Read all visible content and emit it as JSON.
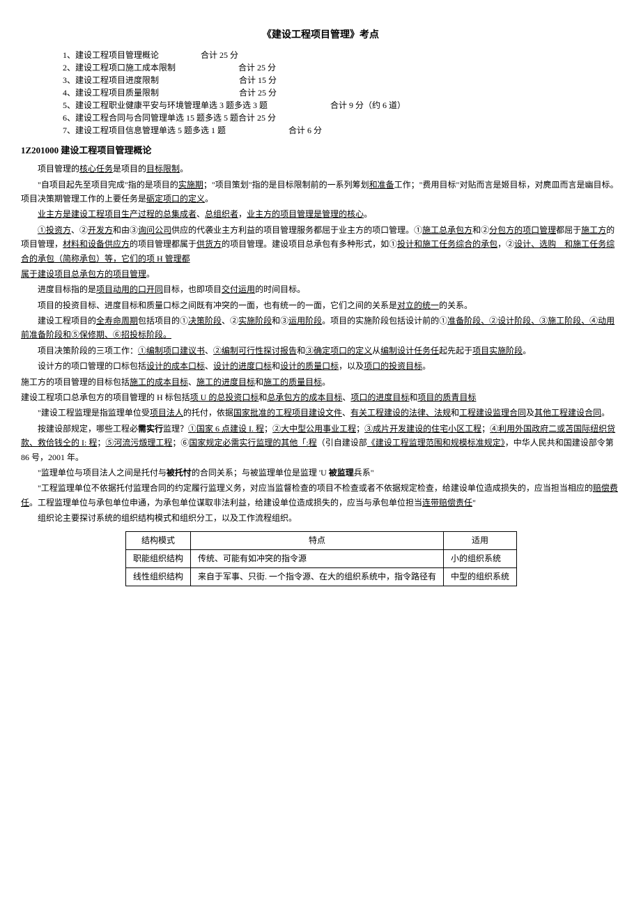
{
  "title": "《建设工程项目管理》考点",
  "toc": [
    {
      "num": "1、",
      "name": "建设工程项目管理概论",
      "score": "合计 25 分"
    },
    {
      "num": "2、",
      "name": "建设工程项口施工成本限制",
      "score": "合计 25 分"
    },
    {
      "num": "3、",
      "name": "建设工程项目进度限制",
      "score": "合计 15 分"
    },
    {
      "num": "4、",
      "name": "建设工程项目质量限制",
      "score": "合计 25 分"
    },
    {
      "num": "5、",
      "name": "建设工程职业健康平安与环境管理单选 3 题多选 3 题",
      "score": "合计 9 分（约 6 道）"
    },
    {
      "num": "6、",
      "name": "建设工程合同与合同管理单选 15 题多选 5 题合计 25 分",
      "score": ""
    },
    {
      "num": "7、",
      "name": "建设工程项目信息管理单选 5 题多选 1 题",
      "score": "合计 6 分"
    }
  ],
  "section_code": "1Z201000",
  "section_title": "建设工程项目管理概论",
  "p1_a": "项目管理的",
  "p1_u1": "核心任务",
  "p1_b": "是项目的",
  "p1_u2": "目标限制",
  "p1_c": "。",
  "p2_a": "\"自项目起先至项目完成\"指的是项目的",
  "p2_u1": "实施期",
  "p2_b": "；\"项目策划\"指的是目标限制前的一系列筹划",
  "p2_u2": "和准备",
  "p2_c": "工作；\"费用目标\"对贴而言是姬目标，对麂皿而言是幽目标。项目决策期管理工作的上要任务是",
  "p2_u3": "砺定项口的定义",
  "p2_d": "。",
  "p3_u1": "业主方是建设工程项目生产过程的总集成者",
  "p3_a": "、",
  "p3_u2": "总组织者",
  "p3_b": "，",
  "p3_u3": "业主方的项目管理是管理的核心",
  "p3_c": "。",
  "p4_u1": "①投资方",
  "p4_a": "、②",
  "p4_u2": "开发方",
  "p4_b": "和由③",
  "p4_u3": "询问公司",
  "p4_c": "供应的代袭业主方利益的项目管理服务都屈于业主方的项口管理。①",
  "p4_u4": "施工总承包方",
  "p4_d": "和②",
  "p4_u5": "分包方的项口管理",
  "p4_e": "都屈于",
  "p4_u6": "施工方",
  "p4_f": "的项目管理，",
  "p4_u7": "材料和设备供应方",
  "p4_g": "的项目管理都属于",
  "p4_u8": "供货方",
  "p4_h": "的项目管理。建设项目总承包有多种形式，如①",
  "p4_u9": "投计和施工任务综合的承包",
  "p4_i": "，②",
  "p4_u10": "设计、选购　和施工任务综合的承包（简称承包）等，它们的项 H 管理都",
  "p5_u1": "属于建设项目总承包方的项目管理",
  "p5_a": "。",
  "p6_a": "进度目标指的是",
  "p6_u1": "项目动用的口开同",
  "p6_b": "目标，也即项目",
  "p6_u2": "交付运用",
  "p6_c": "的时间目标。",
  "p7_a": "项目的投资目标、进度目标和质量口标之间既有冲突的一面，也有统一的一面，它们之间的关系是",
  "p7_u1": "对立的统一",
  "p7_b": "的关系。",
  "p8_a": "建设工程项目的",
  "p8_u1": "全寿命周期",
  "p8_b": "包括项目的①",
  "p8_u2": "决策阶段",
  "p8_c": "、②",
  "p8_u3": "实施阶段",
  "p8_d": "和③",
  "p8_u4": "运用阶段",
  "p8_e": "。项目的实施阶段包括设计前的①",
  "p8_u5": "准备阶段、②设计阶段、③施工阶段、④动用前准备阶段和⑤保修期、⑥招投标阶段。",
  "p9_a": "项目决策阶段的三项工作：",
  "p9_u1": "①编制项口建议书",
  "p9_b": "、",
  "p9_u2": "②编制可行性探讨报告",
  "p9_c": "和",
  "p9_u3": "③确定项口的定义",
  "p9_d": "从",
  "p9_u4": "编制设计任务任",
  "p9_e": "起先起于",
  "p9_u5": "项目实施阶段",
  "p9_f": "。",
  "p10_a": "设计方的项口管理的口标包括",
  "p10_u1": "设计的成本口标",
  "p10_b": "、",
  "p10_u2": "设计的进度口标",
  "p10_c": "和",
  "p10_u3": "设计的质量口标",
  "p10_d": "，以及",
  "p10_u4": "项口的投资目标",
  "p10_e": "。",
  "p11_a": "施工方的项目管理的目标包括",
  "p11_u1": "施工的成本目标",
  "p11_b": "、",
  "p11_u2": "施工的进度目标",
  "p11_c": "和",
  "p11_u3": "施工的质量目标",
  "p11_d": "。",
  "p12_a": "建设工程项口总承包方的项目管理的 H 标包括",
  "p12_u1": "项 U 的总投资口标",
  "p12_b": "和",
  "p12_u2": "总承包方的成本目标",
  "p12_c": "、",
  "p12_u3": "项口的进度目标",
  "p12_d": "和",
  "p12_u4": "项目的质青目标",
  "p13_a": "\"建设工程监理是指监理单位受",
  "p13_u1": "项目法人",
  "p13_b": "的托付，依据",
  "p13_u2": "国家批准的工程项目建设文件",
  "p13_c": "、",
  "p13_u3": "有关工程建设的法律、法规",
  "p13_d": "和",
  "p13_u4": "工程建设监理合同",
  "p13_e": "及",
  "p13_u5": "其他工程建设合同",
  "p13_f": "。",
  "p14_a": "按建设部规定，哪些工程必",
  "p14_b1": "需实行",
  "p14_b": "监理？",
  "p14_u1": "①国家 6 点建设 I. 程",
  "p14_c": "；",
  "p14_u2": "②大中型公用事业工程",
  "p14_d": "；",
  "p14_u3": "③成片开发建设的住宅小区工程",
  "p14_e": "；",
  "p14_u4": "④利用外国政府二或苫国际纽织贷款、救佮钱仝的 I: 程",
  "p14_f": "；",
  "p14_u5": "⑤河流污燬理工程",
  "p14_g": "；⑥",
  "p14_u6": "国家规定必需实行监理的其他「:程",
  "p14_h": "（引自建设部",
  "p14_u7": "《建设工程监理范围和规模标准规定》",
  "p14_i": "，中华人民共和国建设部令第 86 号，2001 年。",
  "p15_a": "\"监理单位与项目法人之间是托付与",
  "p15_b1": "被托忖",
  "p15_b": "的合同关系；与被监理单位是监理 'U ",
  "p15_b2": "被监理",
  "p15_c": "兵系\"",
  "p16_a": "\"工程监理单位不依据托付监理合同的约定履行监理义务，对应当监督检查的项目不检查或者不依据规定检查，给建设单位造成损失的，应当担当相应的",
  "p16_u1": "赔偿费任",
  "p16_b": "。工程监理单位与承包单位申通，为承包单位谋取非法利益，给建设单位造成损失的，应当与承包单位担当",
  "p16_u2": "连带赔偿责任",
  "p16_c": "\"",
  "p17": "组织论主要探讨系统的组织结构模式和组织分工，以及工作流程组织。",
  "table": {
    "headers": [
      "结构模式",
      "特点",
      "适用"
    ],
    "rows": [
      [
        "职能组织结构",
        "传统、可能有如冲突的指令源",
        "小的组织系统"
      ],
      [
        "线性组织结构",
        "来自于军事、只街. 一个指令源、在大的组织系统中，指令路径有",
        "中型的组织系统"
      ]
    ]
  }
}
